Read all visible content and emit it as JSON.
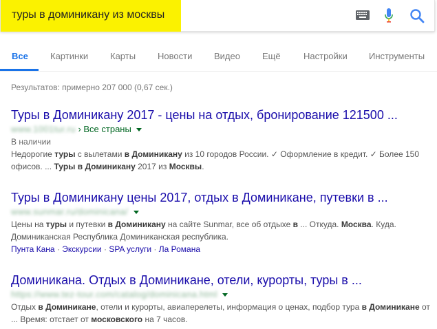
{
  "search": {
    "query": "туры в доминикану из москвы"
  },
  "icons": {
    "keyboard": "keyboard-icon",
    "mic": "mic-icon",
    "search": "search-icon"
  },
  "colors": {
    "highlight": "#fbf200",
    "link": "#1a0dab",
    "url_green": "#006621",
    "tab_active": "#1a73e8"
  },
  "tabs": [
    {
      "label": "Все",
      "active": true
    },
    {
      "label": "Картинки"
    },
    {
      "label": "Карты"
    },
    {
      "label": "Новости"
    },
    {
      "label": "Видео"
    },
    {
      "label": "Ещё"
    },
    {
      "label": "Настройки"
    },
    {
      "label": "Инструменты"
    }
  ],
  "stats": "Результатов: примерно 207 000 (0,67 сек.)",
  "results": [
    {
      "title": "Туры в Доминикану 2017 - цены на отдых, бронирование 121500 ...",
      "url_blurred": "www.1001tur.ru",
      "breadcrumb": "› Все страны",
      "extra": "В наличии",
      "snippet": [
        {
          "t": "Недорогие "
        },
        {
          "t": "туры",
          "b": true
        },
        {
          "t": " с вылетами "
        },
        {
          "t": "в Доминикану",
          "b": true
        },
        {
          "t": " из 10 городов России. ✓ Оформление в кредит. ✓ Более 150 офисов. ... "
        },
        {
          "t": "Туры в Доминикану",
          "b": true
        },
        {
          "t": " 2017 из "
        },
        {
          "t": "Москвы",
          "b": true
        },
        {
          "t": "."
        }
      ]
    },
    {
      "title": "Туры в Доминикану цены 2017, отдых в Доминикане, путевки в ...",
      "url_blurred": "www.sunmar.ru/dominicana/",
      "snippet": [
        {
          "t": "Цены на "
        },
        {
          "t": "туры",
          "b": true
        },
        {
          "t": " и путевки "
        },
        {
          "t": "в Доминикану",
          "b": true
        },
        {
          "t": " на сайте Sunmar, все об отдыхе "
        },
        {
          "t": "в",
          "b": true
        },
        {
          "t": " ... Откуда. "
        },
        {
          "t": "Москва",
          "b": true
        },
        {
          "t": ". Куда. Доминиканская Республика Доминиканская республика."
        }
      ],
      "sitelinks": [
        "Пунта Кана",
        "Экскурсии",
        "SPA услуги",
        "Ла Романа"
      ]
    },
    {
      "title": "Доминикана. Отдых в Доминикане, отели, курорты, туры в ...",
      "url_blurred": "https://www.tez-tour.com/catalog/dominicana.html",
      "snippet": [
        {
          "t": "Отдых "
        },
        {
          "t": "в Доминикане",
          "b": true
        },
        {
          "t": ", отели и курорты, авиаперелеты, информация о ценах, подбор тура "
        },
        {
          "t": "в Доминикане",
          "b": true
        },
        {
          "t": " от ... Время: отстает от "
        },
        {
          "t": "московского",
          "b": true
        },
        {
          "t": " на 7 часов."
        }
      ]
    }
  ]
}
